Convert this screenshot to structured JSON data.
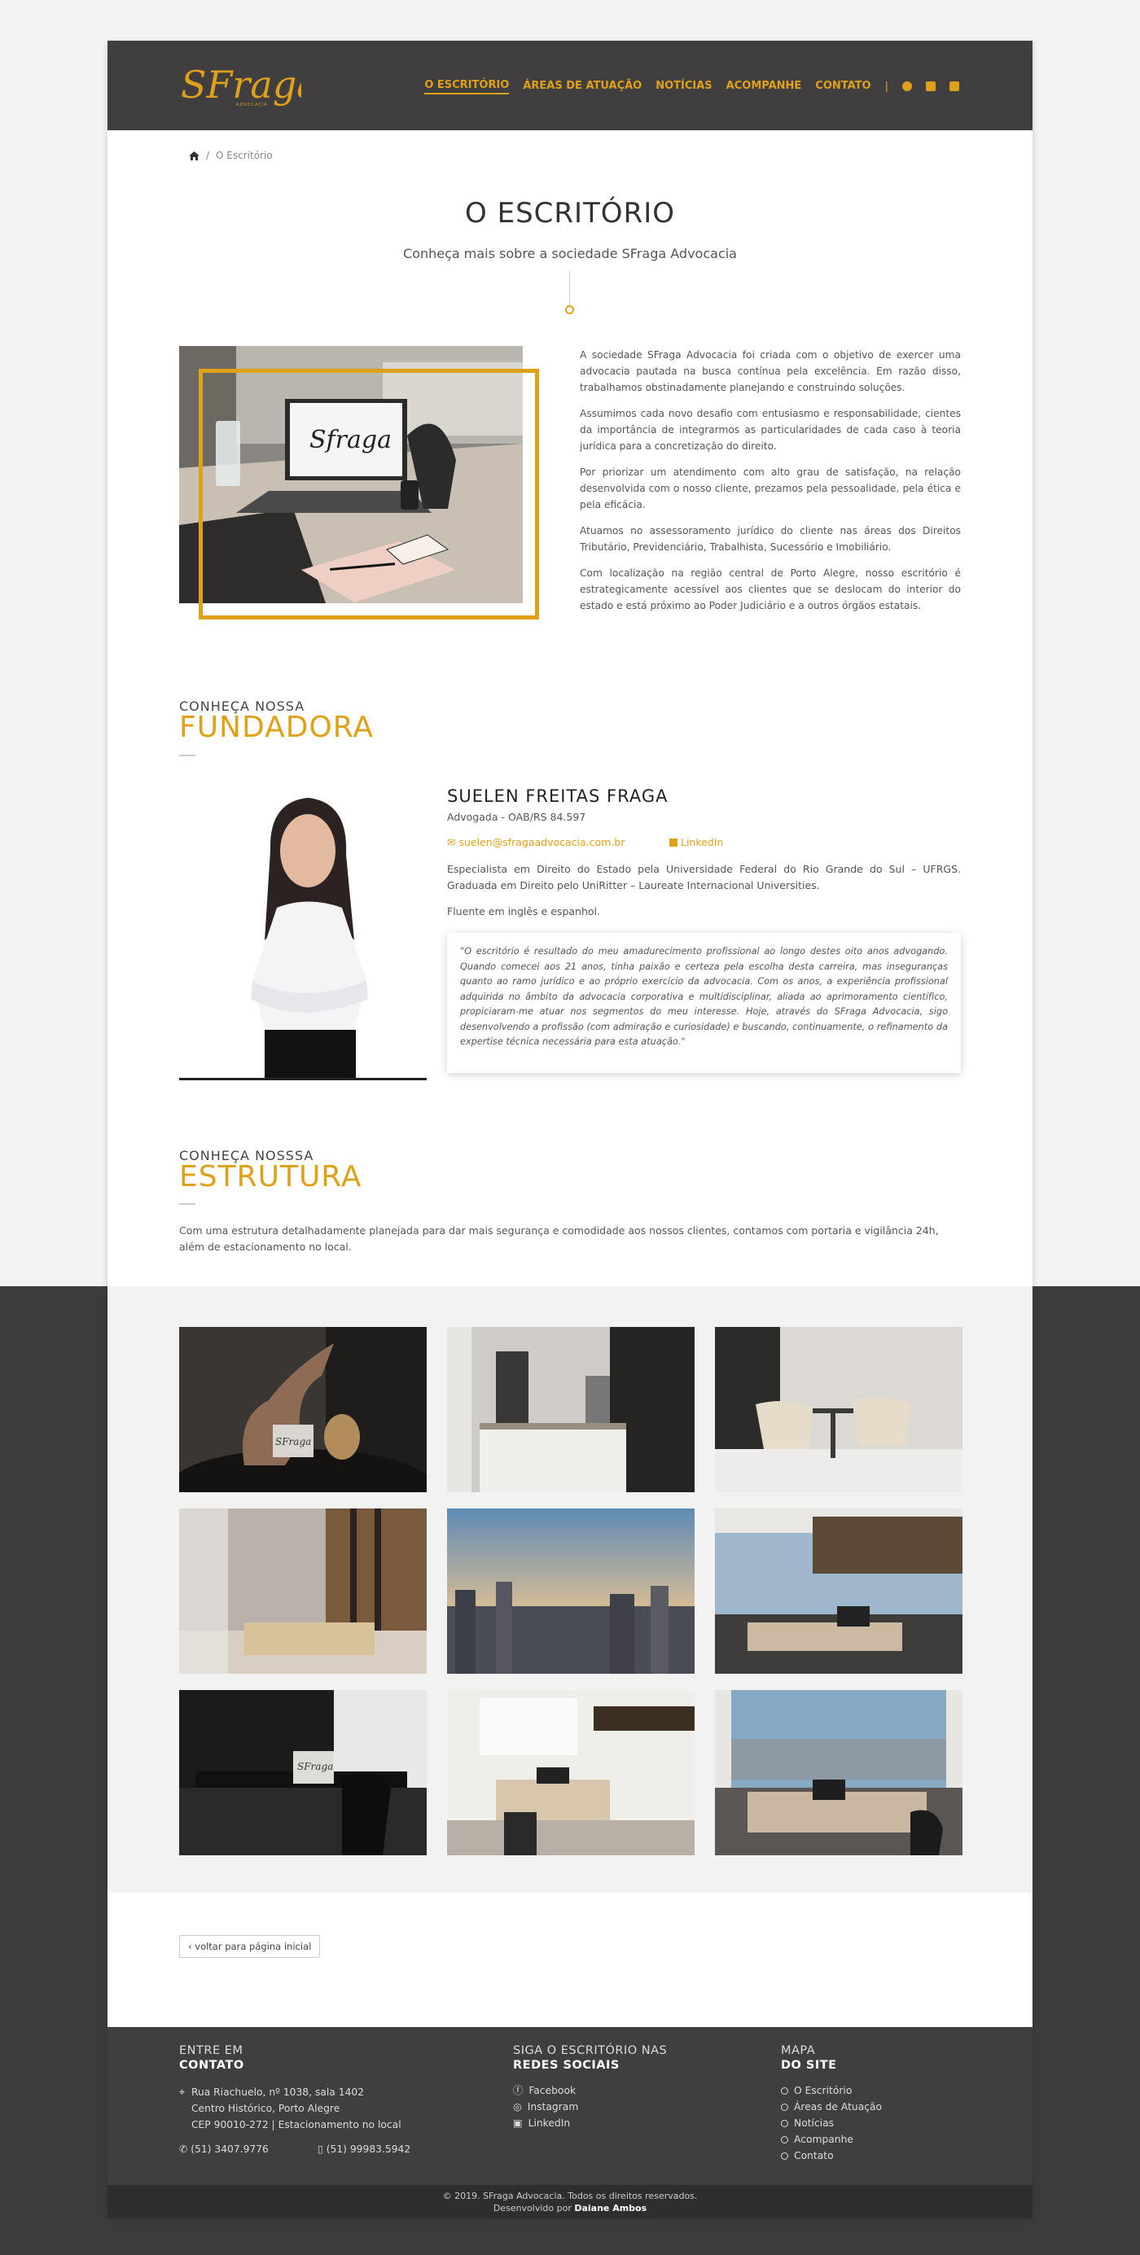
{
  "header": {
    "logo_text": "SFraga",
    "logo_tagline": "ADVOCACIA",
    "nav": [
      "O ESCRITÓRIO",
      "ÁREAS DE ATUAÇÃO",
      "NOTÍCIAS",
      "ACOMPANHE",
      "CONTATO"
    ],
    "separator": "|",
    "social_icons": [
      "facebook-icon",
      "instagram-icon",
      "linkedin-icon"
    ],
    "accent_color": "#e0a11a",
    "bg_color": "#403e3f"
  },
  "breadcrumb": {
    "home_icon": "home-icon",
    "separator": "/",
    "current": "O Escritório"
  },
  "page": {
    "title": "O ESCRITÓRIO",
    "subtitle": "Conheça mais sobre a sociedade SFraga Advocacia"
  },
  "about": {
    "image_logo": "Sfraga",
    "paragraphs": [
      "A sociedade SFraga Advocacia foi criada com o objetivo de exercer uma advocacia pautada na busca contínua pela excelência. Em razão disso, trabalhamos obstinadamente planejando e construindo soluções.",
      "Assumimos cada novo desafio com entusiasmo e responsabilidade, cientes da importância de integrarmos as particularidades de cada caso à teoria jurídica para a concretização do direito.",
      "Por priorizar um atendimento com alto grau de satisfação, na relação desenvolvida com o nosso cliente, prezamos pela pessoalidade, pela ética e pela eficácia.",
      "Atuamos no assessoramento jurídico do cliente nas áreas dos Direitos Tributário, Previdenciário, Trabalhista, Sucessório e Imobiliário.",
      "Com localização na região central de Porto Alegre, nosso escritório é estrategicamente acessível aos clientes que se deslocam do interior do estado e está próximo ao Poder Judiciário e a outros órgãos estatais."
    ]
  },
  "founder": {
    "heading_small": "CONHEÇA NOSSA",
    "heading_big": "FUNDADORA",
    "name": "SUELEN FREITAS FRAGA",
    "role": "Advogada - OAB/RS 84.597",
    "email": "suelen@sfragaadvocacia.com.br",
    "linkedin": "LinkedIn",
    "description": "Especialista em Direito do Estado pela Universidade Federal do Rio Grande do Sul – UFRGS. Graduada em Direito pelo UniRitter – Laureate Internacional Universities.",
    "languages": "Fluente em inglês e espanhol.",
    "quote": "\"O escritório é resultado do meu amadurecimento profissional ao longo destes oito anos advogando. Quando comecei aos 21 anos, tinha paixão e certeza pela escolha desta carreira, mas inseguranças quanto ao ramo jurídico e ao próprio exercício da advocacia. Com os anos, a experiência profissional adquirida no âmbito da advocacia corporativa e multidisciplinar, aliada ao aprimoramento científico, propiciaram-me atuar nos segmentos do meu interesse. Hoje, através do SFraga Advocacia, sigo desenvolvendo a profissão (com admiração e curiosidade) e buscando, continuamente, o refinamento da expertise técnica necessária para esta atuação.\""
  },
  "structure": {
    "heading_small": "CONHEÇA NOSSSA",
    "heading_big": "ESTRUTURA",
    "text": "Com uma estrutura detalhadamente planejada para dar mais segurança e comodidade aos nossos clientes, contamos com portaria e vigilância 24h, além de estacionamento no local."
  },
  "gallery": {
    "photos": [
      "photo-sculpture",
      "photo-reception",
      "photo-meeting-chairs",
      "photo-hallway",
      "photo-city-sunset",
      "photo-office-window",
      "photo-desk-dark",
      "photo-office-bookshelf",
      "photo-office-view"
    ],
    "plaque_text": "SFraga"
  },
  "back_button": "voltar para página inicial",
  "footer": {
    "contact_small": "ENTRE EM",
    "contact_big": "CONTATO",
    "address_lines": [
      "Rua Riachuelo, nº 1038, sala 1402",
      "Centro Histórico, Porto Alegre",
      "CEP 90010-272 | Estacionamento no local"
    ],
    "phone": "(51) 3407.9776",
    "mobile": "(51) 99983.5942",
    "social_small": "SIGA O ESCRITÓRIO NAS",
    "social_big": "REDES SOCIAIS",
    "social_links": [
      "Facebook",
      "Instagram",
      "LinkedIn"
    ],
    "sitemap_small": "MAPA",
    "sitemap_big": "DO SITE",
    "sitemap_links": [
      "O Escritório",
      "Áreas de Atuação",
      "Notícias",
      "Acompanhe",
      "Contato"
    ]
  },
  "copyright": {
    "line1": "© 2019. SFraga Advocacia. Todos os direitos reservados.",
    "line2_prefix": "Desenvolvido por",
    "developer": "Daiane Ambos"
  }
}
